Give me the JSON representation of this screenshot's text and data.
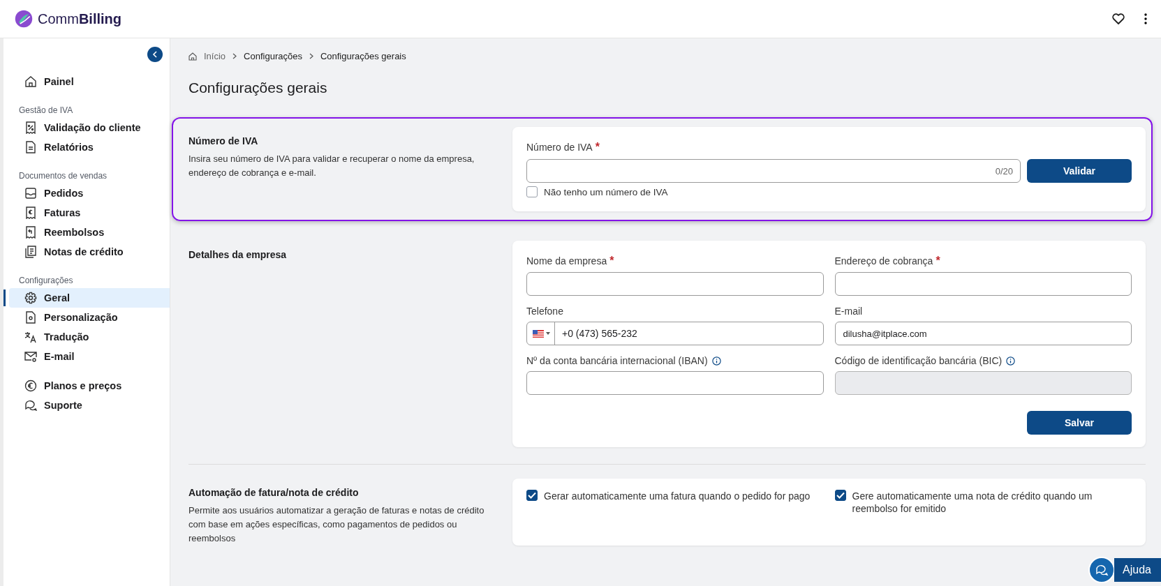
{
  "header": {
    "logo": {
      "light": "Comm",
      "bold": "Billing"
    }
  },
  "sidebar": {
    "groups": [
      {
        "items": [
          {
            "label": "Painel",
            "selected": false
          }
        ]
      },
      {
        "title": "Gestão de IVA",
        "items": [
          {
            "label": "Validação do cliente",
            "selected": false
          },
          {
            "label": "Relatórios",
            "selected": false
          }
        ]
      },
      {
        "title": "Documentos de vendas",
        "items": [
          {
            "label": "Pedidos",
            "selected": false
          },
          {
            "label": "Faturas",
            "selected": false
          },
          {
            "label": "Reembolsos",
            "selected": false
          },
          {
            "label": "Notas de crédito",
            "selected": false
          }
        ]
      },
      {
        "title": "Configurações",
        "items": [
          {
            "label": "Geral",
            "selected": true
          },
          {
            "label": "Personalização",
            "selected": false
          },
          {
            "label": "Tradução",
            "selected": false
          },
          {
            "label": "E-mail",
            "selected": false
          }
        ]
      },
      {
        "items": [
          {
            "label": "Planos e preços",
            "selected": false
          },
          {
            "label": "Suporte",
            "selected": false
          }
        ]
      }
    ]
  },
  "breadcrumb": [
    "Início",
    "Configurações",
    "Configurações gerais"
  ],
  "page_title": "Configurações gerais",
  "vat_section": {
    "highlighted": true,
    "title": "Número de IVA",
    "description": "Insira seu número de IVA para validar e recuperar o nome da empresa, endereço de cobrança e e-mail.",
    "field": {
      "label": "Número de IVA",
      "required_mark": "*",
      "counter": "0/20"
    },
    "button": "Validar",
    "checkbox": {
      "label": "Não tenho um número de IVA",
      "checked": false
    }
  },
  "company_section": {
    "title": "Detalhes da empresa",
    "fields": [
      {
        "kind": "text",
        "label": "Nome da empresa",
        "required_mark": "*",
        "info": false,
        "disabled": false
      },
      {
        "kind": "text",
        "label": "Endereço de cobrança",
        "required_mark": "*",
        "info": false,
        "disabled": false
      },
      {
        "kind": "phone",
        "label": "Telefone",
        "info": false,
        "disabled": false,
        "value": "+0 (473) 565-232"
      },
      {
        "kind": "text",
        "label": "E-mail",
        "info": false,
        "disabled": false,
        "value": "dilusha@itplace.com"
      },
      {
        "kind": "text",
        "label": "Nº da conta bancária internacional (IBAN)",
        "info": true,
        "disabled": false
      },
      {
        "kind": "text",
        "label": "Código de identificação bancária (BIC)",
        "info": true,
        "disabled": true
      }
    ],
    "button": "Salvar"
  },
  "automation_section": {
    "title": "Automação de fatura/nota de crédito",
    "description": "Permite aos usuários automatizar a geração de faturas e notas de crédito com base em ações específicas, como pagamentos de pedidos ou reembolsos",
    "options": [
      {
        "label": "Gerar automaticamente uma fatura quando o pedido for pago",
        "checked": true
      },
      {
        "label": "Gere automaticamente uma nota de crédito quando um reembolso for emitido",
        "checked": true
      }
    ]
  },
  "help_button": "Ajuda"
}
